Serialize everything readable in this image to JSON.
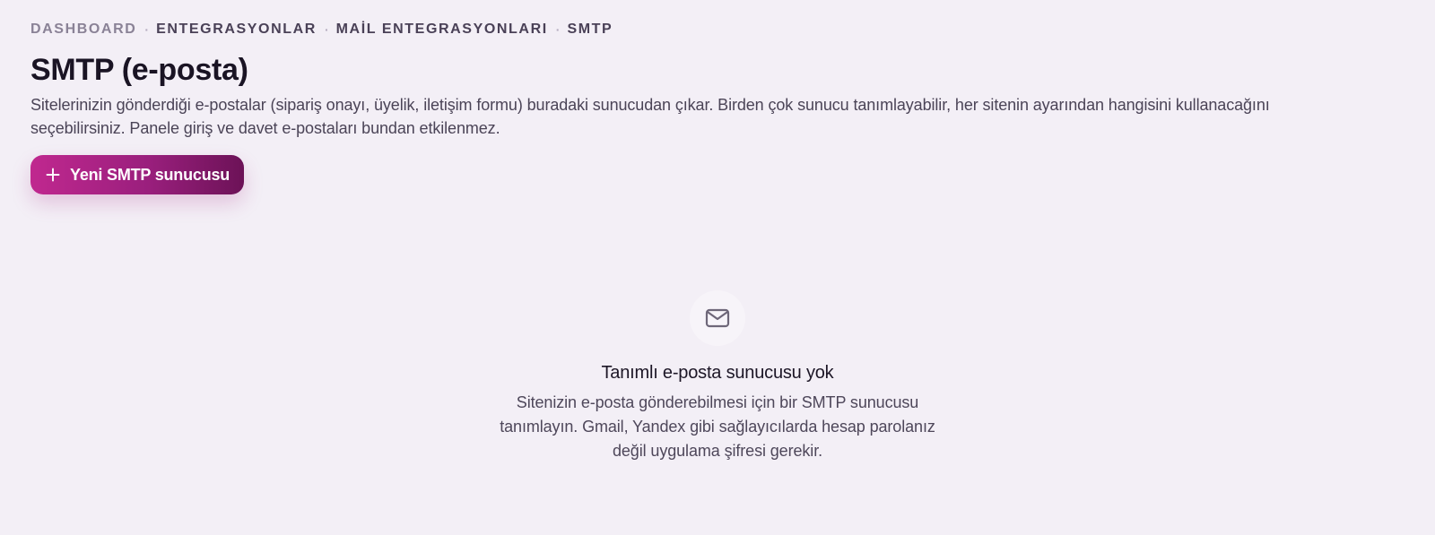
{
  "breadcrumb": {
    "items": [
      "DASHBOARD",
      "ENTEGRASYONLAR",
      "MAİL ENTEGRASYONLARI",
      "SMTP"
    ],
    "separator": "·"
  },
  "header": {
    "title": "SMTP (e-posta)",
    "description": "Sitelerinizin gönderdiği e-postalar (sipariş onayı, üyelik, iletişim formu) buradaki sunucudan çıkar. Birden çok sunucu tanımlayabilir, her sitenin ayarından hangisini kullanacağını seçebilirsiniz. Panele giriş ve davet e-postaları bundan etkilenmez."
  },
  "actions": {
    "new_server_label": "Yeni SMTP sunucusu",
    "new_server_icon": "plus-icon"
  },
  "empty_state": {
    "icon": "mail-icon",
    "title": "Tanımlı e-posta sunucusu yok",
    "description": "Sitenizin e-posta gönderebilmesi için bir SMTP sunucusu tanımlayın. Gmail, Yandex gibi sağlayıcılarda hesap parolanız değil uygulama şifresi gerekir."
  },
  "colors": {
    "background": "#f3eff6",
    "accent_start": "#c0288f",
    "accent_end": "#6c1257",
    "text_primary": "#1a1424",
    "text_muted": "#4b4457"
  }
}
